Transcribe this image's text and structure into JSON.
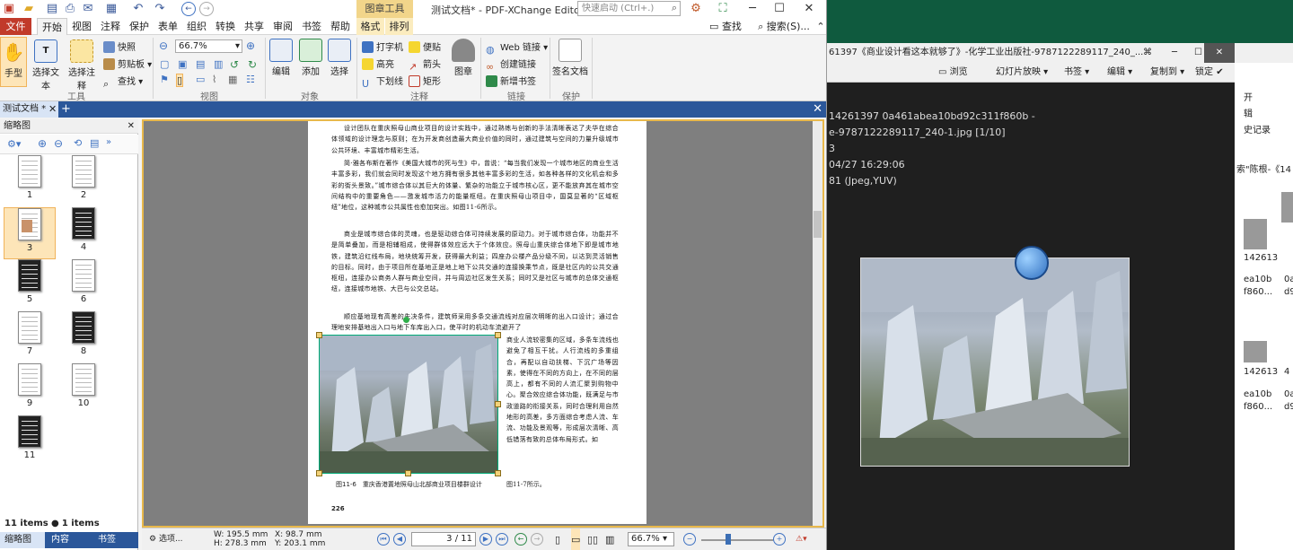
{
  "editor": {
    "context_tab": "图章工具",
    "title": "测试文档* - PDF-XChange Editor",
    "quick_launch_placeholder": "快速启动 (Ctrl+.)",
    "menu": [
      "文件",
      "开始",
      "视图",
      "注释",
      "保护",
      "表单",
      "组织",
      "转换",
      "共享",
      "审阅",
      "书签",
      "帮助",
      "格式",
      "排列"
    ],
    "menu_right": {
      "find": "查找(F)...",
      "search": "搜索(S)..."
    },
    "ribbon": {
      "hand": "手型",
      "select_text": "选择文本",
      "select_annotation": "选择注释",
      "snapshot": "快照",
      "clipboard": "剪贴板",
      "find": "查找",
      "zoom_value": "66.7%",
      "edit": "编辑",
      "add": "添加",
      "select": "选择",
      "typewriter": "打字机",
      "sticky_note": "便贴",
      "highlight": "高亮",
      "arrow": "箭头",
      "underline": "下划线",
      "rectangle": "矩形",
      "stamp": "图章",
      "web_link": "Web 链接",
      "create_link": "创建链接",
      "new_bookmark": "新增书签",
      "sign_document": "签名文档",
      "groups": {
        "tools": "工具",
        "view": "视图",
        "objects": "对象",
        "comment": "注释",
        "links": "链接",
        "protect": "保护"
      }
    },
    "doc_tab": "测试文档 *",
    "thumb_panel": {
      "title": "缩略图",
      "pages": [
        "1",
        "2",
        "3",
        "4",
        "5",
        "6",
        "7",
        "8",
        "9",
        "10",
        "11"
      ],
      "selected": "3",
      "status_count": "11 items",
      "status_selected": "1 items selected"
    },
    "bottom_tabs": [
      "缩略图",
      "内容",
      "书签"
    ],
    "page": {
      "p1": "设计团队在重庆照母山商业项目的设计实践中，通过熟练与创新的手法清晰表达了夫华在综合体领域的设计理念与原则；在为开发商创造最大商业价值的同时，通过建筑与空间的力量升级城市公共环境、丰富城市精彩生活。",
      "p2": "简·雅各布斯在著作《美国大城市的死与生》中，曾说：“每当我们发现一个城市地区的商业生活丰富多彩，我们就会同时发现这个地方拥有很多其他丰富多彩的生活，如各种各样的文化机会和多彩的街头景致。”城市综合体以其巨大的体量、繁杂的功能立于城市核心区，更不能放弃其在城市空间结构中的重要角色——激发城市活力的能量枢纽。在重庆照母山项目中，国莫显著的“区域枢纽”地位，这种城市公共属性也愈加突出。如图11-6所示。",
      "p3": "商业是城市综合体的灵魂，也是驱动综合体可持续发展的原动力。对于城市综合体，功能并不是简单叠加，而是相辅相成，使得群体效应远大于个体效应。照母山重庆综合体地下即是城市地铁，建筑沿红线布局，地块统筹开发，获得最大利益；四座办公楼产品分级不同，以达到灵活销售的目标。同时，由于项目所在基地正是地上地下公共交通的连接换乘节点，既是社区内的公共交通枢纽，连接办公商务人群与商业空间，并与周边社区发生关系；同时又是社区与城市的总体交通枢纽，连接城市地铁、大巴与公交总站。",
      "p4": "顺应基地现有高差的先决条件，建筑师采用多条交通流线对应层次明晰的出入口设计；通过合理地安排基地出入口与地下车库出入口，使平时的机动车流避开了",
      "p5": "商业人流较密集的区域，多条车流线也避免了相互干扰。人行流线的多重组合，再配以自动扶梯、下沉广场等因素，使得在不同的方向上，在不同的层高上，都有不同的人流汇聚到购物中心。聚合效应综合体功能，既满足与市政道路的衔接关系，同时合理利用自然地形的高差，多方面综合考虑人流、车流、功能及景观等，形成层次清晰、高低错落有致的总体布局形式。如",
      "caption": "图11-6　重庆香港置地照母山北部商业项目楼群设计",
      "caption_suffix": "图11-7所示。",
      "page_number": "226"
    },
    "status": {
      "options": "选项...",
      "w": "W: 195.5 mm",
      "h": "H: 278.3 mm",
      "x": "X:     98.7 mm",
      "y": "Y: 203.1 mm",
      "page_of": "3 / 11",
      "zoom": "66.7%"
    }
  },
  "viewer": {
    "title": "61397《商业设计看这本就够了》-化学工业出版社-9787122289117_240_...",
    "toolbar": [
      "浏览",
      "幻灯片放映",
      "书签",
      "编辑",
      "复制到",
      "锁定"
    ],
    "info": [
      "14261397 0a461abea10bd92c311f860b -",
      "e-9787122289117_240-1.jpg [1/10]",
      "3",
      "04/27 16:29:06",
      "81 (Jpeg,YUV)"
    ]
  },
  "bgwin": {
    "texts": [
      "开",
      "辑",
      "史记录",
      "索\"陈根-《14",
      "142613",
      "ea10b",
      "f860...",
      "0a",
      "d9",
      "142613",
      "ea10b",
      "f860...",
      "4",
      "0a",
      "d9"
    ]
  },
  "colors": {
    "accent": "#2b579a",
    "file": "#c13a2a",
    "selection": "#fde5b8",
    "desktop": "#0f5a3e"
  }
}
